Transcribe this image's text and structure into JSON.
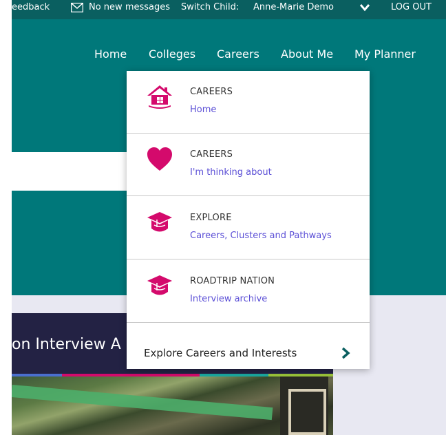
{
  "topbar": {
    "feedback": "eedback",
    "messages": "No new messages",
    "switch_child_label": "Switch Child:",
    "child_name": "Anne-Marie Demo",
    "logout": "LOG OUT"
  },
  "nav": {
    "home": "Home",
    "colleges": "Colleges",
    "careers": "Careers",
    "about_me": "About Me",
    "my_planner": "My Planner"
  },
  "dropdown": {
    "items": [
      {
        "category": "CAREERS",
        "label": "Home",
        "icon": "house-icon"
      },
      {
        "category": "CAREERS",
        "label": "I'm thinking about",
        "icon": "heart-icon"
      },
      {
        "category": "EXPLORE",
        "label": "Careers, Clusters and Pathways",
        "icon": "graduation-cap-icon"
      },
      {
        "category": "ROADTRIP NATION",
        "label": "Interview archive",
        "icon": "graduation-cap-icon"
      }
    ],
    "footer_label": "Explore Careers and Interests"
  },
  "card": {
    "title": "on Interview A"
  },
  "colors": {
    "topbar": "#0a5f60",
    "hero": "#00787a",
    "accent": "#d40a6c",
    "link": "#5b4fd6",
    "footer_chevron": "#0a5f60"
  }
}
